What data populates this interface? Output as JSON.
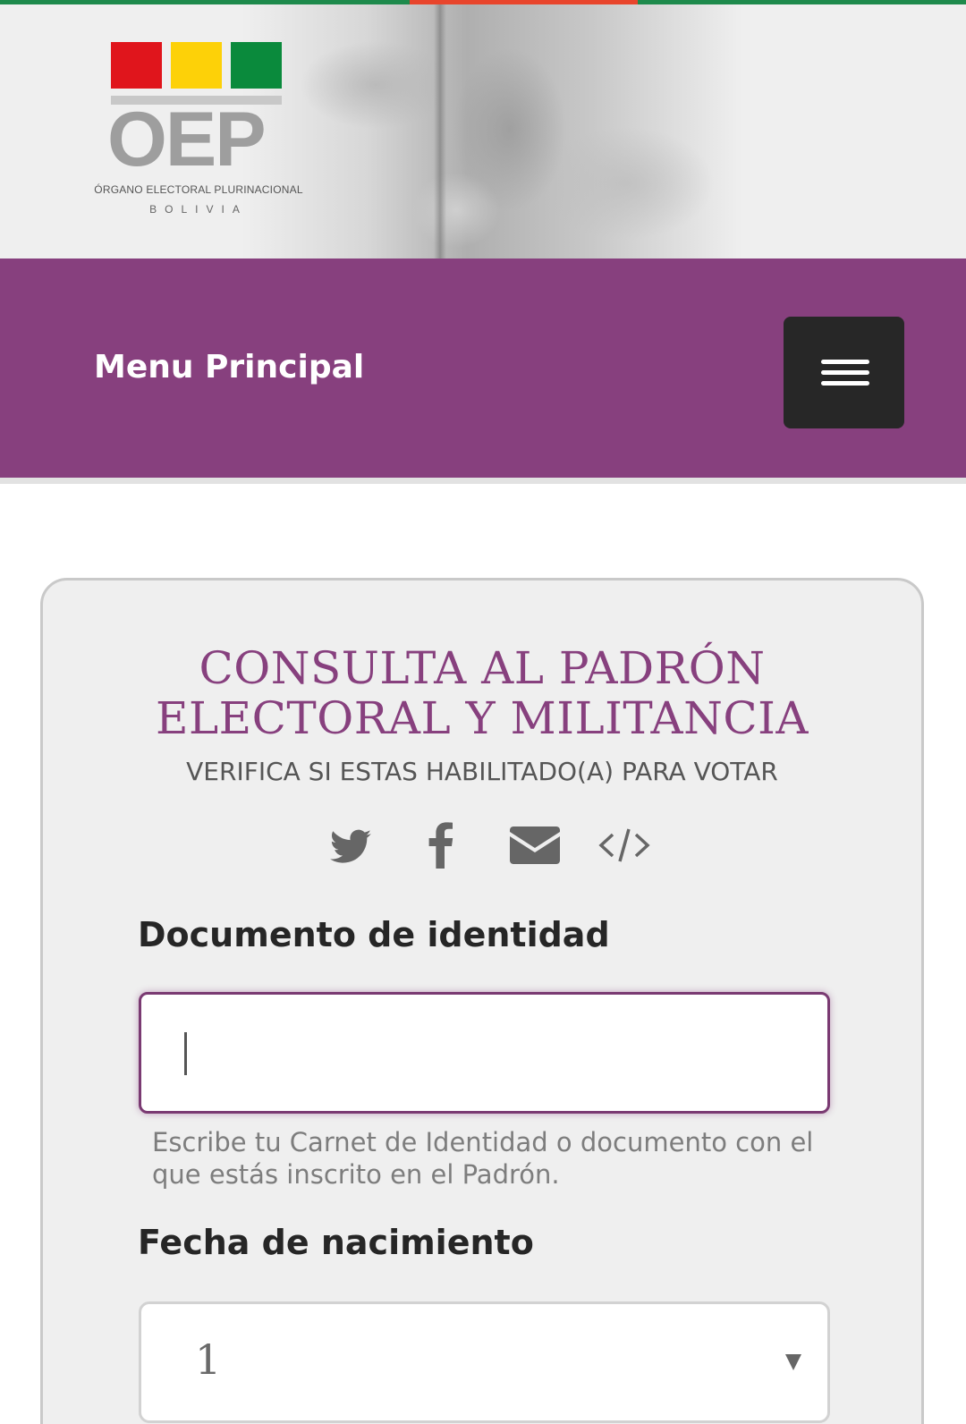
{
  "colors": {
    "brand_purple": "#87407e",
    "menu_button_bg": "#272727",
    "flag_red": "#e0151c",
    "flag_yellow": "#fdd108",
    "flag_green": "#0a8a3c"
  },
  "header": {
    "logo": {
      "acronym": "OEP",
      "organization": "ÓRGANO ELECTORAL PLURINACIONAL",
      "country": "BOLIVIA"
    }
  },
  "nav": {
    "title": "Menu Principal",
    "menu_button_icon": "hamburger-menu-icon"
  },
  "consulta": {
    "title_line1": "CONSULTA AL PADRÓN",
    "title_line2": "ELECTORAL Y MILITANCIA",
    "subtitle": "VERIFICA SI ESTAS HABILITADO(A) PARA VOTAR",
    "share_icons": [
      "twitter-icon",
      "facebook-icon",
      "email-icon",
      "embed-code-icon"
    ]
  },
  "form": {
    "document_label": "Documento de identidad",
    "document_value": "",
    "document_help": "Escribe tu Carnet de Identidad o documento con el que estás inscrito en el Padrón.",
    "birthdate_label": "Fecha de nacimiento",
    "day_selected": "1"
  }
}
